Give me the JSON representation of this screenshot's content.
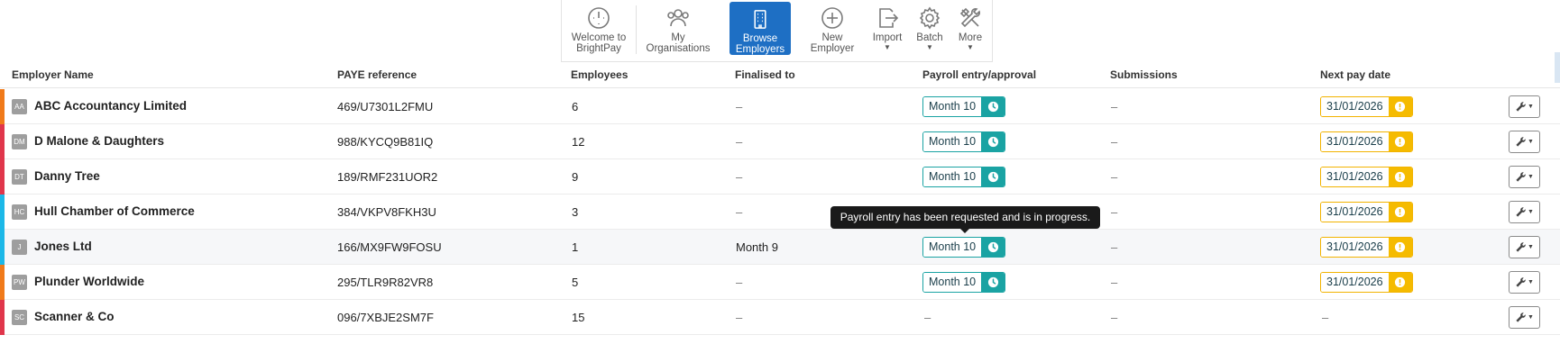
{
  "toolbar": {
    "welcome": "Welcome to\nBrightPay",
    "orgs": "My\nOrganisations",
    "browse": "Browse\nEmployers",
    "new_employer": "New\nEmployer",
    "import": "Import",
    "batch": "Batch",
    "more": "More"
  },
  "columns": {
    "name": "Employer Name",
    "paye": "PAYE reference",
    "employees": "Employees",
    "finalised": "Finalised to",
    "payroll": "Payroll entry/approval",
    "submissions": "Submissions",
    "next_pay": "Next pay date"
  },
  "rows": [
    {
      "initials": "AA",
      "name": "ABC Accountancy Limited",
      "paye": "469/U7301L2FMU",
      "employees": "6",
      "finalised": "–",
      "payroll": "Month 10",
      "submissions": "–",
      "next_pay": "31/01/2026",
      "stripe": "#f07a1a"
    },
    {
      "initials": "DM",
      "name": "D Malone & Daughters",
      "paye": "988/KYCQ9B81IQ",
      "employees": "12",
      "finalised": "–",
      "payroll": "Month 10",
      "submissions": "–",
      "next_pay": "31/01/2026",
      "stripe": "#e0364b"
    },
    {
      "initials": "DT",
      "name": "Danny Tree",
      "paye": "189/RMF231UOR2",
      "employees": "9",
      "finalised": "–",
      "payroll": "Month 10",
      "submissions": "–",
      "next_pay": "31/01/2026",
      "stripe": "#e0364b"
    },
    {
      "initials": "HC",
      "name": "Hull Chamber of Commerce",
      "paye": "384/VKPV8FKH3U",
      "employees": "3",
      "finalised": "–",
      "payroll": "",
      "submissions": "–",
      "next_pay": "31/01/2026",
      "stripe": "#1cb8e8"
    },
    {
      "initials": "J",
      "name": "Jones Ltd",
      "paye": "166/MX9FW9FOSU",
      "employees": "1",
      "finalised": "Month 9",
      "payroll": "Month 10",
      "submissions": "–",
      "next_pay": "31/01/2026",
      "stripe": "#1cb8e8"
    },
    {
      "initials": "PW",
      "name": "Plunder Worldwide",
      "paye": "295/TLR9R82VR8",
      "employees": "5",
      "finalised": "–",
      "payroll": "Month 10",
      "submissions": "–",
      "next_pay": "31/01/2026",
      "stripe": "#f07a1a"
    },
    {
      "initials": "SC",
      "name": "Scanner & Co",
      "paye": "096/7XBJE2SM7F",
      "employees": "15",
      "finalised": "–",
      "payroll": "–",
      "submissions": "–",
      "next_pay": "–",
      "stripe": "#e0364b"
    }
  ],
  "tooltip": "Payroll entry has been requested and is in progress.",
  "colors": {
    "accent": "#1e6fc4",
    "teal": "#1aa3a3",
    "gold": "#f5bb00"
  }
}
